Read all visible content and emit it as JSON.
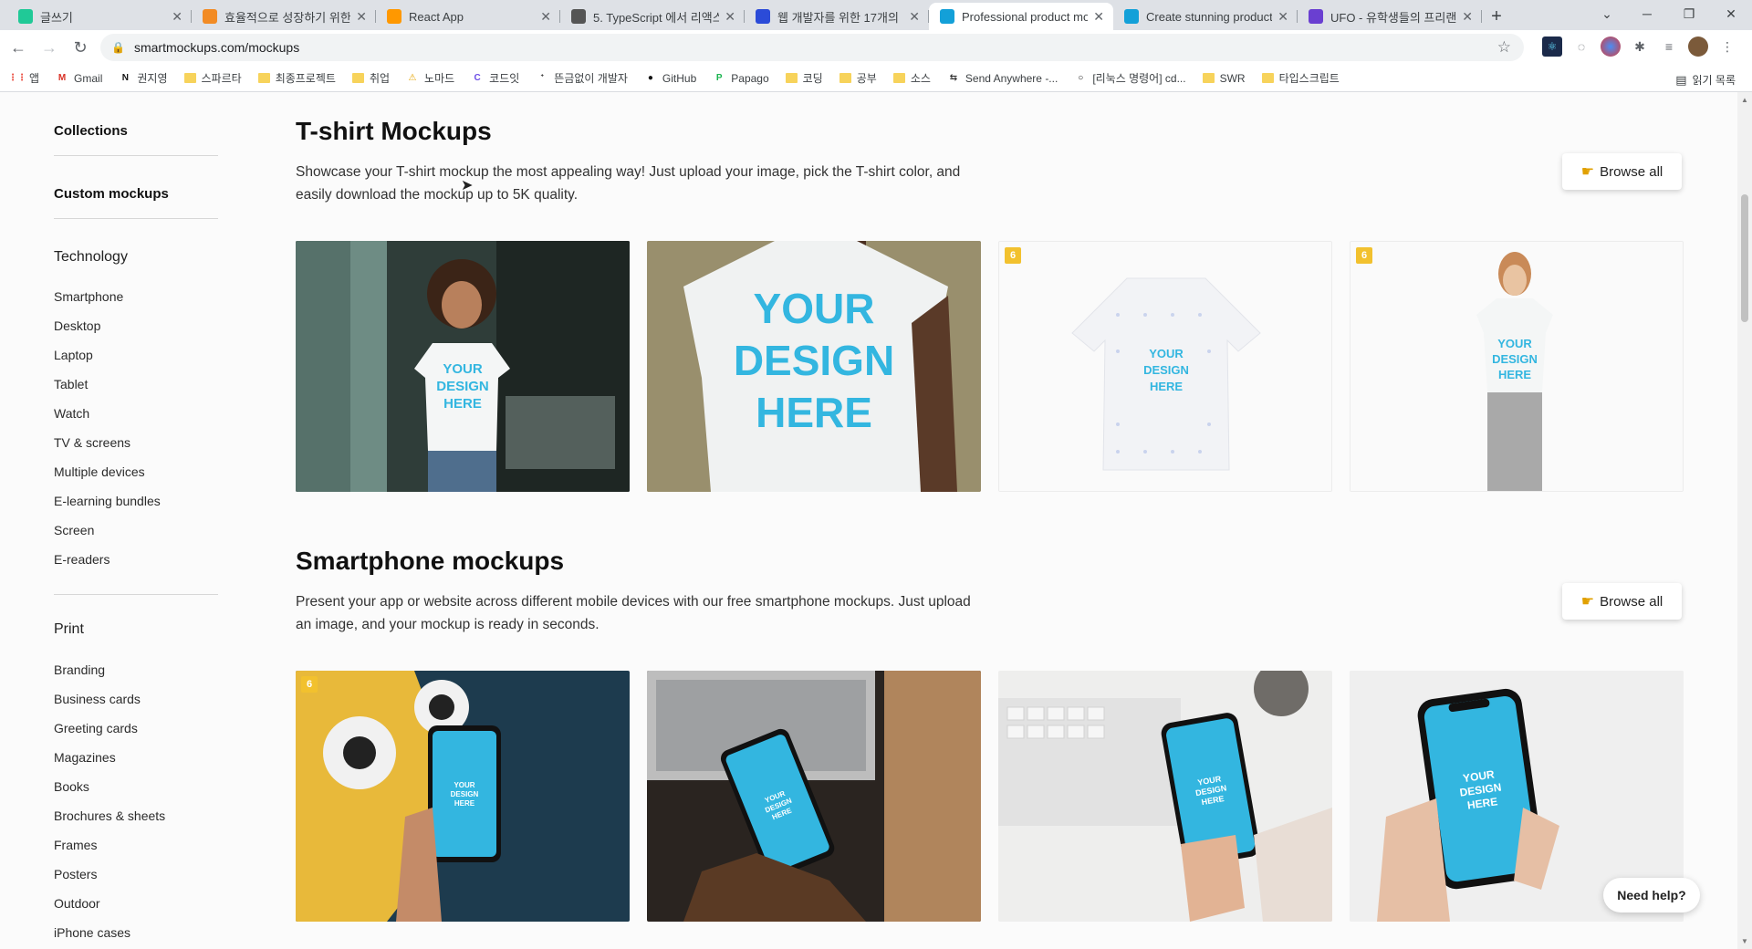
{
  "browser": {
    "tabs": [
      {
        "title": "글쓰기",
        "icon": "velog-icon",
        "color": "#20c997"
      },
      {
        "title": "효율적으로 성장하기 위한",
        "icon": "fire-icon",
        "color": "#f28b24"
      },
      {
        "title": "React App",
        "icon": "cloud-icon",
        "color": "#ff9800"
      },
      {
        "title": "5. TypeScript 에서 리액스",
        "icon": "book-icon",
        "color": "#555555"
      },
      {
        "title": "웹 개발자를 위한 17개의",
        "icon": "js-icon",
        "color": "#2b4bd8"
      },
      {
        "title": "Professional product moc",
        "icon": "smartmockups-icon",
        "color": "#13a0d8",
        "active": true
      },
      {
        "title": "Create stunning product",
        "icon": "smartmockups-icon",
        "color": "#13a0d8"
      },
      {
        "title": "UFO - 유학생들의 프리랜",
        "icon": "ufo-icon",
        "color": "#6a3fd1"
      }
    ],
    "url": "smartmockups.com/mockups",
    "bookmarks": [
      {
        "label": "앱",
        "icon": "apps-grid-icon"
      },
      {
        "label": "Gmail",
        "icon": "gmail-icon"
      },
      {
        "label": "권지영",
        "icon": "notion-icon"
      },
      {
        "label": "스파르타",
        "icon": "folder-icon"
      },
      {
        "label": "최종프로젝트",
        "icon": "folder-icon"
      },
      {
        "label": "취업",
        "icon": "folder-icon"
      },
      {
        "label": "노마드",
        "icon": "nomad-icon"
      },
      {
        "label": "코드잇",
        "icon": "codeit-icon"
      },
      {
        "label": "뜬금없이 개발자",
        "icon": "velog-icon"
      },
      {
        "label": "GitHub",
        "icon": "github-icon"
      },
      {
        "label": "Papago",
        "icon": "papago-icon"
      },
      {
        "label": "코딩",
        "icon": "folder-icon"
      },
      {
        "label": "공부",
        "icon": "folder-icon"
      },
      {
        "label": "소스",
        "icon": "folder-icon"
      },
      {
        "label": "Send Anywhere -...",
        "icon": "send-anywhere-icon"
      },
      {
        "label": "[리눅스 명령어] cd...",
        "icon": "circle-icon"
      },
      {
        "label": "SWR",
        "icon": "folder-icon"
      },
      {
        "label": "타입스크립트",
        "icon": "folder-icon"
      }
    ],
    "reading_list": "읽기 목록"
  },
  "sidebar": {
    "collections": "Collections",
    "custom": "Custom mockups",
    "technology": {
      "heading": "Technology",
      "items": [
        "Smartphone",
        "Desktop",
        "Laptop",
        "Tablet",
        "Watch",
        "TV & screens",
        "Multiple devices",
        "E-learning bundles",
        "Screen",
        "E-readers"
      ]
    },
    "print": {
      "heading": "Print",
      "items": [
        "Branding",
        "Business cards",
        "Greeting cards",
        "Magazines",
        "Books",
        "Brochures & sheets",
        "Frames",
        "Posters",
        "Outdoor",
        "iPhone cases"
      ]
    }
  },
  "sections": [
    {
      "title": "T-shirt Mockups",
      "description": "Showcase your T-shirt mockup the most appealing way! Just upload your image, pick the T-shirt color, and easily download the mockup up to 5K quality.",
      "browse_label": "Browse all",
      "cards": [
        {
          "design_text": "YOUR DESIGN HERE",
          "badge": null
        },
        {
          "design_text": "YOUR DESIGN HERE",
          "badge": null
        },
        {
          "design_text": "YOUR DESIGN HERE",
          "badge": "6"
        },
        {
          "design_text": "YOUR DESIGN HERE",
          "badge": "6"
        }
      ]
    },
    {
      "title": "Smartphone mockups",
      "description": "Present your app or website across different mobile devices with our free smartphone mockups. Just upload an image, and your mockup is ready in seconds.",
      "browse_label": "Browse all",
      "cards": [
        {
          "design_text": "YOUR DESIGN HERE",
          "badge": "6"
        },
        {
          "design_text": "YOUR DESIGN HERE",
          "badge": null
        },
        {
          "design_text": "YOUR DESIGN HERE",
          "badge": null
        },
        {
          "design_text": "YOUR DESIGN HERE",
          "badge": null
        }
      ]
    }
  ],
  "help": "Need help?",
  "colors": {
    "accent_cyan": "#33b6e0",
    "badge": "#f2c12e"
  }
}
